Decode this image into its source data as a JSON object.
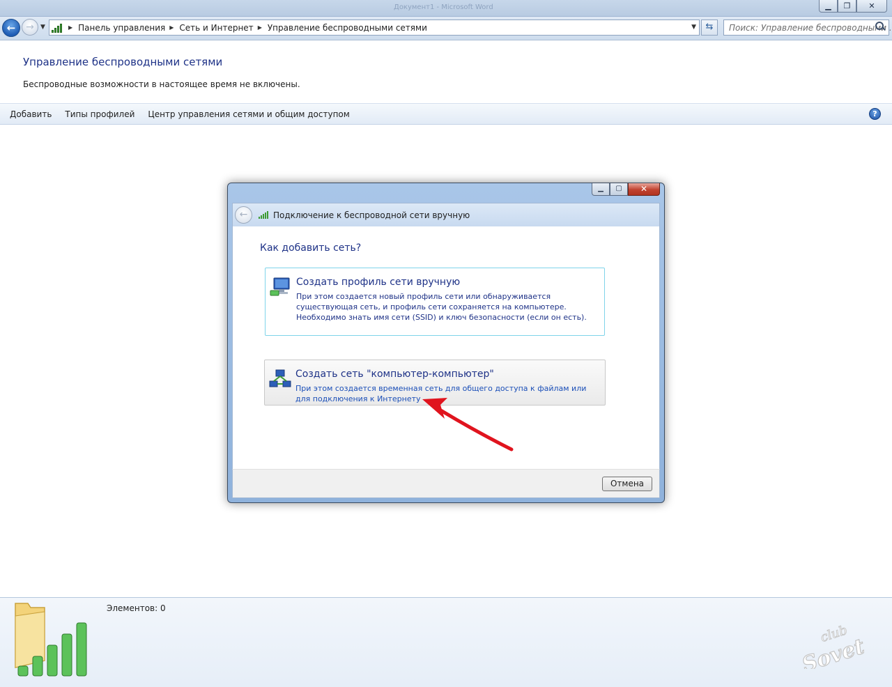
{
  "window": {
    "background_title": "Документ1 - Microsoft Word"
  },
  "address_bar": {
    "crumbs": [
      "Панель управления",
      "Сеть и Интернет",
      "Управление беспроводными сетями"
    ],
    "search_placeholder": "Поиск: Управление беспроводными ..."
  },
  "page": {
    "title": "Управление беспроводными сетями",
    "subtitle": "Беспроводные возможности в настоящее время не включены."
  },
  "commands": {
    "add": "Добавить",
    "profile_types": "Типы профилей",
    "network_center": "Центр управления сетями и общим доступом"
  },
  "details": {
    "items_count": "Элементов: 0"
  },
  "dialog": {
    "title": "Подключение к беспроводной сети вручную",
    "question": "Как добавить сеть?",
    "options": [
      {
        "title": "Создать профиль сети вручную",
        "description": "При этом создается новый профиль сети или обнаруживается существующая сеть, и профиль сети сохраняется на компьютере. Необходимо знать имя сети (SSID) и ключ безопасности (если он есть).",
        "icon": "network-computer-icon"
      },
      {
        "title": "Создать сеть \"компьютер-компьютер\"",
        "description": "При этом создается временная сеть для общего доступа к файлам или для подключения к Интернету",
        "icon": "ad-hoc-network-icon"
      }
    ],
    "cancel": "Отмена"
  },
  "watermark": {
    "text": "club Sovet"
  },
  "colors": {
    "link_blue": "#1e3287",
    "annotation_arrow": "#e0141e",
    "signal_green": "#3c9b32"
  }
}
